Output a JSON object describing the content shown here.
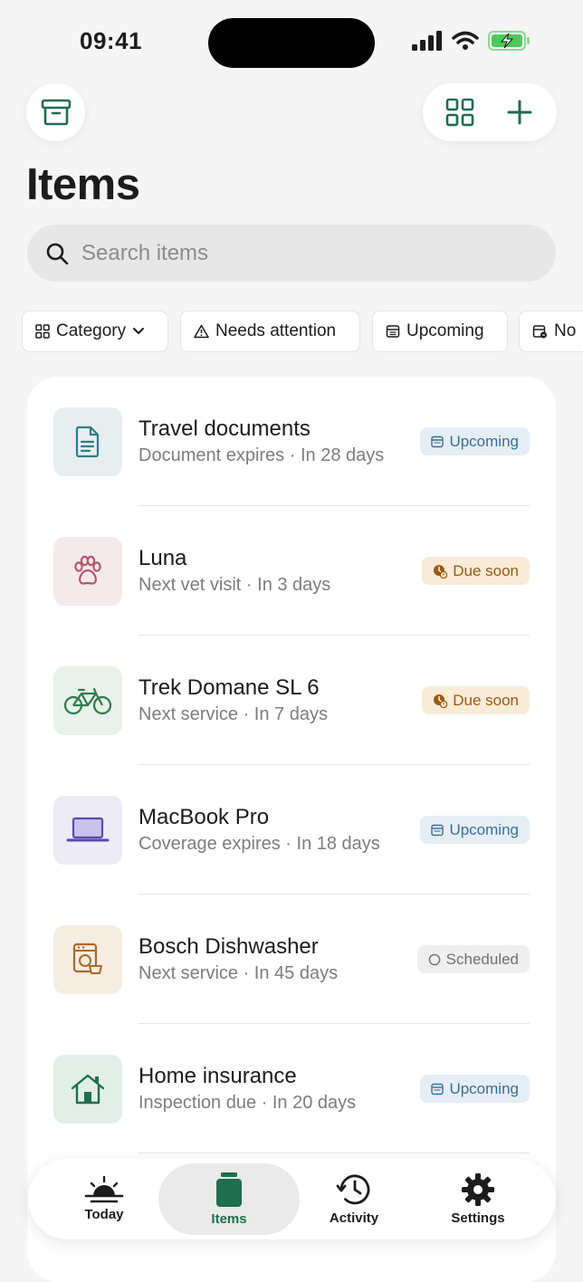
{
  "status_bar": {
    "time": "09:41"
  },
  "header": {
    "title": "Items",
    "archive_icon": "archive-box-icon",
    "grid_icon": "grid-view-icon",
    "add_icon": "plus-icon"
  },
  "search": {
    "placeholder": "Search items",
    "value": ""
  },
  "filters": [
    {
      "label": "Category",
      "icon": "grid-icon"
    },
    {
      "label": "Needs attention",
      "icon": "warning-triangle-icon"
    },
    {
      "label": "Upcoming",
      "icon": "calendar-icon"
    },
    {
      "label": "No",
      "icon": "calendar-x-icon"
    }
  ],
  "items": [
    {
      "title": "Travel documents",
      "subtitle": "Document expires · In 28 days",
      "status": "Upcoming",
      "icon": "document-icon"
    },
    {
      "title": "Luna",
      "subtitle": "Next vet visit · In 3 days",
      "status": "Due soon",
      "icon": "paw-icon"
    },
    {
      "title": "Trek Domane SL 6",
      "subtitle": "Next service · In 7 days",
      "status": "Due soon",
      "icon": "bicycle-icon"
    },
    {
      "title": "MacBook Pro",
      "subtitle": "Coverage expires · In 18 days",
      "status": "Upcoming",
      "icon": "laptop-icon"
    },
    {
      "title": "Bosch Dishwasher",
      "subtitle": "Next service · In 45 days",
      "status": "Scheduled",
      "icon": "dishwasher-icon"
    },
    {
      "title": "Home insurance",
      "subtitle": "Inspection due · In 20 days",
      "status": "Upcoming",
      "icon": "house-icon"
    }
  ],
  "tabs": [
    {
      "label": "Today",
      "icon": "sunrise-icon"
    },
    {
      "label": "Items",
      "icon": "jar-icon",
      "active": true
    },
    {
      "label": "Activity",
      "icon": "history-clock-icon"
    },
    {
      "label": "Settings",
      "icon": "gear-icon"
    }
  ],
  "colors": {
    "accent": "#1f6e4d",
    "upcoming": "#3a6e96",
    "due_soon": "#9b5a0f",
    "scheduled": "#6f7270",
    "background": "#f4f5f4"
  }
}
